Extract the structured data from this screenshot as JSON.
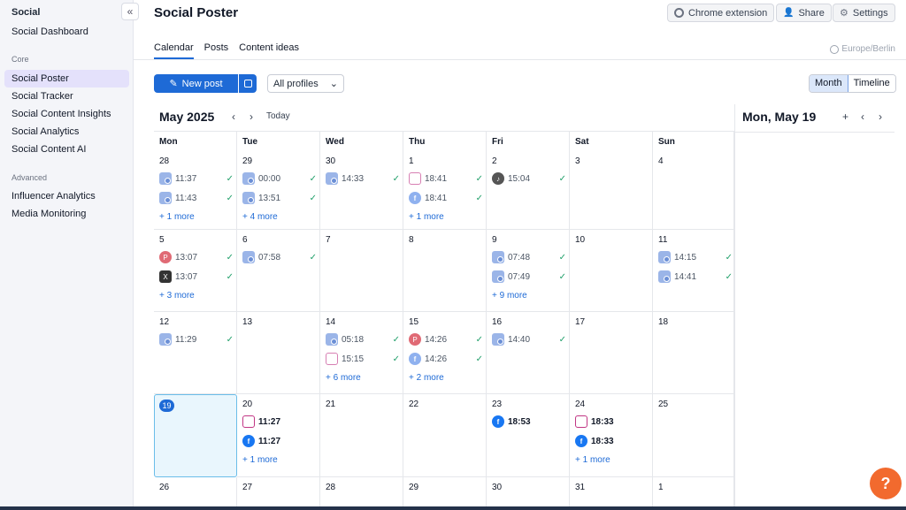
{
  "sidebar": {
    "title": "Social",
    "collapse_glyph": "«",
    "dashboard": "Social Dashboard",
    "section_core": "Core",
    "core_items": [
      "Social Poster",
      "Social Tracker",
      "Social Content Insights",
      "Social Analytics",
      "Social Content AI"
    ],
    "section_advanced": "Advanced",
    "advanced_items": [
      "Influencer Analytics",
      "Media Monitoring"
    ]
  },
  "header": {
    "title": "Social Poster",
    "chrome_extension": "Chrome extension",
    "share": "Share",
    "settings": "Settings"
  },
  "tabs": [
    "Calendar",
    "Posts",
    "Content ideas"
  ],
  "timezone": "Europe/Berlin",
  "toolbar": {
    "new_post": "New post",
    "profiles": "All profiles",
    "view_month": "Month",
    "view_timeline": "Timeline"
  },
  "calendar": {
    "month": "May 2025",
    "prev": "‹",
    "next": "›",
    "today": "Today",
    "weekdays": [
      "Mon",
      "Tue",
      "Wed",
      "Thu",
      "Fri",
      "Sat",
      "Sun"
    ],
    "weeks": [
      [
        {
          "day": "28",
          "posts": [
            {
              "icon": "gmb",
              "time": "11:37",
              "ok": true
            },
            {
              "icon": "gmb",
              "time": "11:43",
              "ok": true
            }
          ],
          "more": "+ 1 more"
        },
        {
          "day": "29",
          "posts": [
            {
              "icon": "gmb",
              "time": "00:00",
              "ok": true
            },
            {
              "icon": "gmb",
              "time": "13:51",
              "ok": true
            }
          ],
          "more": "+ 4 more"
        },
        {
          "day": "30",
          "posts": [
            {
              "icon": "gmb",
              "time": "14:33",
              "ok": true
            }
          ],
          "more": ""
        },
        {
          "day": "1",
          "posts": [
            {
              "icon": "ig",
              "time": "18:41",
              "ok": true
            },
            {
              "icon": "fb",
              "time": "18:41",
              "ok": true
            }
          ],
          "more": "+ 1 more"
        },
        {
          "day": "2",
          "posts": [
            {
              "icon": "tt",
              "time": "15:04",
              "ok": true
            }
          ],
          "more": ""
        },
        {
          "day": "3",
          "posts": [],
          "more": ""
        },
        {
          "day": "4",
          "posts": [],
          "more": ""
        }
      ],
      [
        {
          "day": "5",
          "posts": [
            {
              "icon": "pin",
              "time": "13:07",
              "ok": true
            },
            {
              "icon": "x",
              "time": "13:07",
              "ok": true
            }
          ],
          "more": "+ 3 more"
        },
        {
          "day": "6",
          "posts": [
            {
              "icon": "gmb",
              "time": "07:58",
              "ok": true
            }
          ],
          "more": ""
        },
        {
          "day": "7",
          "posts": [],
          "more": ""
        },
        {
          "day": "8",
          "posts": [],
          "more": ""
        },
        {
          "day": "9",
          "posts": [
            {
              "icon": "gmb",
              "time": "07:48",
              "ok": true
            },
            {
              "icon": "gmb",
              "time": "07:49",
              "ok": true
            }
          ],
          "more": "+ 9 more"
        },
        {
          "day": "10",
          "posts": [],
          "more": ""
        },
        {
          "day": "11",
          "posts": [
            {
              "icon": "gmb",
              "time": "14:15",
              "ok": true
            },
            {
              "icon": "gmb",
              "time": "14:41",
              "ok": true
            }
          ],
          "more": ""
        }
      ],
      [
        {
          "day": "12",
          "posts": [
            {
              "icon": "gmb",
              "time": "11:29",
              "ok": true
            }
          ],
          "more": ""
        },
        {
          "day": "13",
          "posts": [],
          "more": ""
        },
        {
          "day": "14",
          "posts": [
            {
              "icon": "gmb",
              "time": "05:18",
              "ok": true
            },
            {
              "icon": "ig",
              "time": "15:15",
              "ok": true
            }
          ],
          "more": "+ 6 more"
        },
        {
          "day": "15",
          "posts": [
            {
              "icon": "pin",
              "time": "14:26",
              "ok": true
            },
            {
              "icon": "fb",
              "time": "14:26",
              "ok": true
            }
          ],
          "more": "+ 2 more"
        },
        {
          "day": "16",
          "posts": [
            {
              "icon": "gmb",
              "time": "14:40",
              "ok": true
            }
          ],
          "more": ""
        },
        {
          "day": "17",
          "posts": [],
          "more": ""
        },
        {
          "day": "18",
          "posts": [],
          "more": ""
        }
      ],
      [
        {
          "day": "19",
          "today": true,
          "posts": [],
          "more": ""
        },
        {
          "day": "20",
          "posts": [
            {
              "icon": "ig",
              "time": "11:27",
              "ok": false,
              "bold": true
            },
            {
              "icon": "fb",
              "time": "11:27",
              "ok": false,
              "bold": true
            }
          ],
          "more": "+ 1 more"
        },
        {
          "day": "21",
          "posts": [],
          "more": ""
        },
        {
          "day": "22",
          "posts": [],
          "more": ""
        },
        {
          "day": "23",
          "posts": [
            {
              "icon": "fb",
              "time": "18:53",
              "ok": false,
              "bold": true
            }
          ],
          "more": ""
        },
        {
          "day": "24",
          "posts": [
            {
              "icon": "ig",
              "time": "18:33",
              "ok": false,
              "bold": true
            },
            {
              "icon": "fb",
              "time": "18:33",
              "ok": false,
              "bold": true
            }
          ],
          "more": "+ 1 more"
        },
        {
          "day": "25",
          "posts": [],
          "more": ""
        }
      ],
      [
        {
          "day": "26",
          "posts": [],
          "more": ""
        },
        {
          "day": "27",
          "posts": [],
          "more": ""
        },
        {
          "day": "28",
          "posts": [],
          "more": ""
        },
        {
          "day": "29",
          "posts": [],
          "more": ""
        },
        {
          "day": "30",
          "posts": [],
          "more": ""
        },
        {
          "day": "31",
          "posts": [],
          "more": ""
        },
        {
          "day": "1",
          "posts": [],
          "more": ""
        }
      ]
    ]
  },
  "day_panel": {
    "title": "Mon, May 19",
    "add": "+",
    "prev": "‹",
    "next": "›"
  },
  "help": "?",
  "colors": {
    "accent": "#1e6ad6",
    "check": "#22a06b",
    "help": "#f26a2e"
  }
}
